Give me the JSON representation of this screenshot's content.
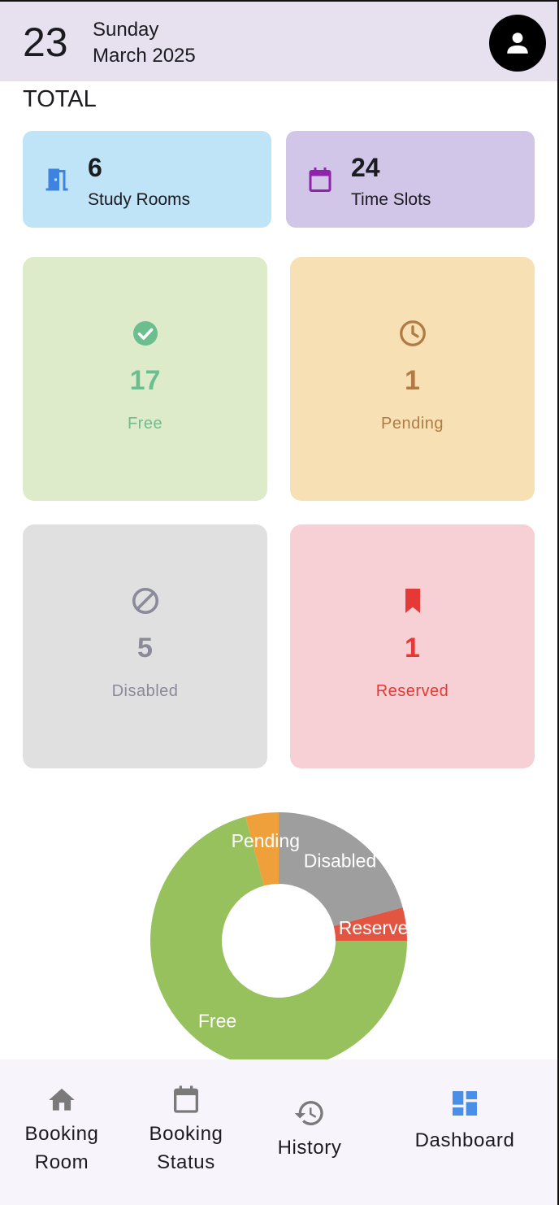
{
  "header": {
    "day": "23",
    "weekday": "Sunday",
    "month_year": "March 2025"
  },
  "section": {
    "title": "TOTAL"
  },
  "summary": [
    {
      "value": "6",
      "label": "Study Rooms",
      "icon": "door-icon",
      "bg": "#bfe3f7",
      "icon_color": "#3d83df"
    },
    {
      "value": "24",
      "label": "Time Slots",
      "icon": "calendar-icon",
      "bg": "#d1c6e7",
      "icon_color": "#8e24aa"
    }
  ],
  "stats": [
    {
      "value": "17",
      "label": "Free",
      "icon": "check-circle-icon",
      "bg": "#deebcb",
      "color": "#6cbe8f"
    },
    {
      "value": "1",
      "label": "Pending",
      "icon": "clock-icon",
      "bg": "#f8e0b5",
      "color": "#b07b45"
    },
    {
      "value": "5",
      "label": "Disabled",
      "icon": "block-icon",
      "bg": "#e0e0e0",
      "color": "#8a8a99"
    },
    {
      "value": "1",
      "label": "Reserved",
      "icon": "bookmark-icon",
      "bg": "#f6d0d4",
      "color": "#e53935"
    }
  ],
  "chart_data": {
    "type": "pie",
    "series": [
      {
        "name": "Disabled",
        "value": 5,
        "color": "#9e9e9e"
      },
      {
        "name": "Reserved",
        "value": 1,
        "color": "#e35541"
      },
      {
        "name": "Free",
        "value": 17,
        "color": "#97c15c"
      },
      {
        "name": "Pending",
        "value": 1,
        "color": "#f0a03a"
      }
    ]
  },
  "nav": {
    "items": [
      {
        "label_line1": "Booking",
        "label_line2": "Room",
        "icon": "home-icon",
        "active": false
      },
      {
        "label_line1": "Booking",
        "label_line2": "Status",
        "icon": "calendar-icon",
        "active": false
      },
      {
        "label_line1": "History",
        "label_line2": "",
        "icon": "history-icon",
        "active": false
      },
      {
        "label_line1": "Dashboard",
        "label_line2": "",
        "icon": "dashboard-icon",
        "active": true
      }
    ],
    "active_color": "#4a8fe7",
    "inactive_color": "#7a7a7a"
  }
}
